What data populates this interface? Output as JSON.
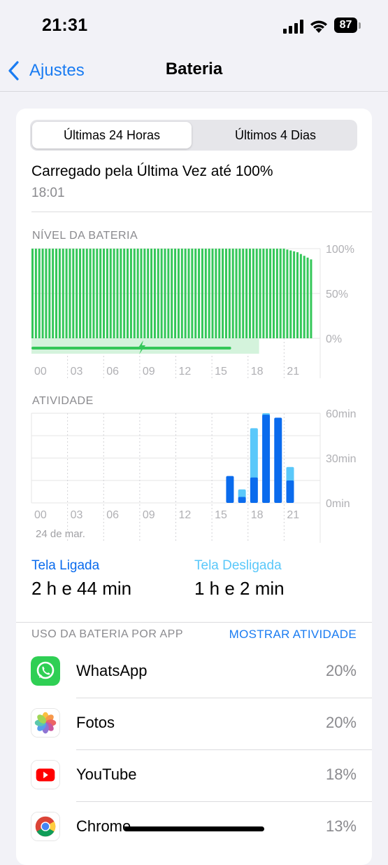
{
  "status_bar": {
    "time": "21:31",
    "battery_level": "87"
  },
  "nav": {
    "back_label": "Ajustes",
    "title": "Bateria"
  },
  "segmented": {
    "option_1": "Últimas 24 Horas",
    "option_2": "Últimos 4 Dias",
    "selected": "Últimas 24 Horas"
  },
  "last_charge": {
    "text": "Carregado pela Última Vez até 100%",
    "time": "18:01"
  },
  "battery_level_chart": {
    "label": "NÍVEL DA BATERIA",
    "y_labels": [
      "100%",
      "50%",
      "0%"
    ],
    "x_labels": [
      "00",
      "03",
      "06",
      "09",
      "12",
      "15",
      "18",
      "21"
    ],
    "values": [
      100,
      100,
      100,
      100,
      100,
      100,
      100,
      100,
      100,
      100,
      100,
      100,
      100,
      100,
      100,
      100,
      100,
      100,
      100,
      100,
      100,
      100,
      100,
      100,
      100,
      100,
      100,
      100,
      100,
      100,
      100,
      100,
      100,
      100,
      100,
      100,
      100,
      100,
      100,
      100,
      100,
      100,
      100,
      100,
      100,
      100,
      100,
      100,
      100,
      100,
      100,
      100,
      100,
      100,
      100,
      100,
      100,
      100,
      100,
      100,
      100,
      100,
      100,
      100,
      100,
      100,
      100,
      100,
      100,
      100,
      100,
      100,
      100,
      100,
      100,
      99,
      98,
      97,
      96,
      94,
      92,
      90,
      88
    ],
    "charging_fraction": 0.74,
    "colors": {
      "bar": "#34c759",
      "charging_bg": "#d4f3dc"
    }
  },
  "activity_chart": {
    "label": "ATIVIDADE",
    "y_labels": [
      "60min",
      "30min",
      "0min"
    ],
    "x_labels": [
      "00",
      "03",
      "06",
      "09",
      "12",
      "15",
      "18",
      "21"
    ],
    "date_label": "24 de mar.",
    "bars": [
      {
        "hour": 16,
        "on": 18,
        "off": 0
      },
      {
        "hour": 17,
        "on": 4,
        "off": 5
      },
      {
        "hour": 18,
        "on": 17,
        "off": 33
      },
      {
        "hour": 19,
        "on": 59,
        "off": 1
      },
      {
        "hour": 20,
        "on": 57,
        "off": 0
      },
      {
        "hour": 21,
        "on": 15,
        "off": 9
      }
    ],
    "colors": {
      "screen_on": "#0a6bed",
      "screen_off": "#5ac8fa"
    }
  },
  "legend": {
    "on_label": "Tela Ligada",
    "on_value": "2 h e 44 min",
    "off_label": "Tela Desligada",
    "off_value": "1 h e 2 min"
  },
  "usage": {
    "label": "USO DA BATERIA POR APP",
    "show_activity": "MOSTRAR ATIVIDADE",
    "apps": [
      {
        "name": "WhatsApp",
        "percent": "20%",
        "icon": "whatsapp-icon"
      },
      {
        "name": "Fotos",
        "percent": "20%",
        "icon": "photos-icon"
      },
      {
        "name": "YouTube",
        "percent": "18%",
        "icon": "youtube-icon"
      },
      {
        "name": "Chrome",
        "percent": "13%",
        "icon": "chrome-icon"
      }
    ]
  }
}
